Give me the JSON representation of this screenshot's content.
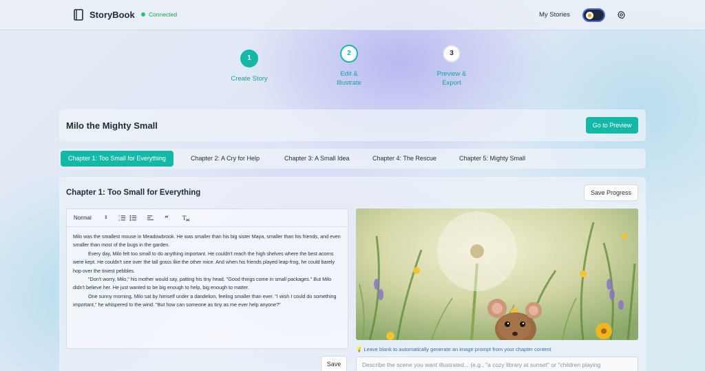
{
  "header": {
    "brand": "StoryBook",
    "status": "Connected",
    "nav_my_stories": "My Stories",
    "icons": [
      "book-icon",
      "theme-toggle",
      "gear-icon"
    ]
  },
  "stepper": {
    "steps": [
      {
        "number": "1",
        "label": "Create Story",
        "state": "completed"
      },
      {
        "number": "2",
        "label": "Edit & Illustrate",
        "state": "current"
      },
      {
        "number": "3",
        "label": "Preview & Export",
        "state": "upcoming"
      }
    ]
  },
  "story": {
    "title": "Milo the Mighty Small",
    "preview_button": "Go to Preview"
  },
  "tabs": [
    {
      "label": "Chapter 1: Too Small for Everything",
      "active": true
    },
    {
      "label": "Chapter 2: A Cry for Help",
      "active": false
    },
    {
      "label": "Chapter 3: A Small Idea",
      "active": false
    },
    {
      "label": "Chapter 4: The Rescue",
      "active": false
    },
    {
      "label": "Chapter 5: Mighty Small",
      "active": false
    }
  ],
  "chapter": {
    "heading": "Chapter 1: Too Small for Everything",
    "save_progress": "Save Progress",
    "save": "Save",
    "editor": {
      "format_select": "Normal",
      "toolbar_icons": [
        "ordered-list-icon",
        "bullet-list-icon",
        "align-icon",
        "quote-icon",
        "clear-format-icon"
      ],
      "paragraphs": [
        "Milo was the smallest mouse in Meadowbrook. He was smaller than his big sister Maya, smaller than his friends, and even smaller than most of the bugs in the garden.",
        "Every day, Milo felt too small to do anything important. He couldn't reach the high shelves where the best acorns were kept. He couldn't see over the tall grass like the other mice. And when his friends played leap-frog, he could barely hop over the tiniest pebbles.",
        "\"Don't worry, Milo,\" his mother would say, patting his tiny head. \"Good things come in small packages.\" But Milo didn't believe her. He just wanted to be big enough to help, big enough to matter.",
        "One sunny morning, Milo sat by himself under a dandelion, feeling smaller than ever. \"I wish I could do something important,\" he whispered to the wind. \"But how can someone as tiny as me ever help anyone?\""
      ]
    },
    "image_hint": "💡 Leave blank to automatically generate an image prompt from your chapter content",
    "prompt_placeholder": "Describe the scene you want illustrated... (e.g., \"a cozy library at sunset\" or \"children playing"
  },
  "colors": {
    "accent": "#14b8a6",
    "status_green": "#22c55e",
    "text_dark": "#1f2a3a"
  }
}
